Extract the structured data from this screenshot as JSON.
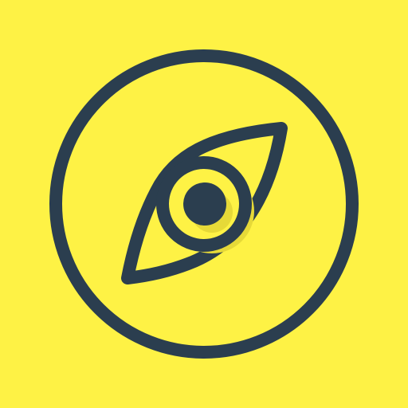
{
  "icon": {
    "name": "compass-eye-icon",
    "colors": {
      "background": "#fef245",
      "stroke": "#2b3e4f",
      "shadow": "#e6d938"
    }
  }
}
